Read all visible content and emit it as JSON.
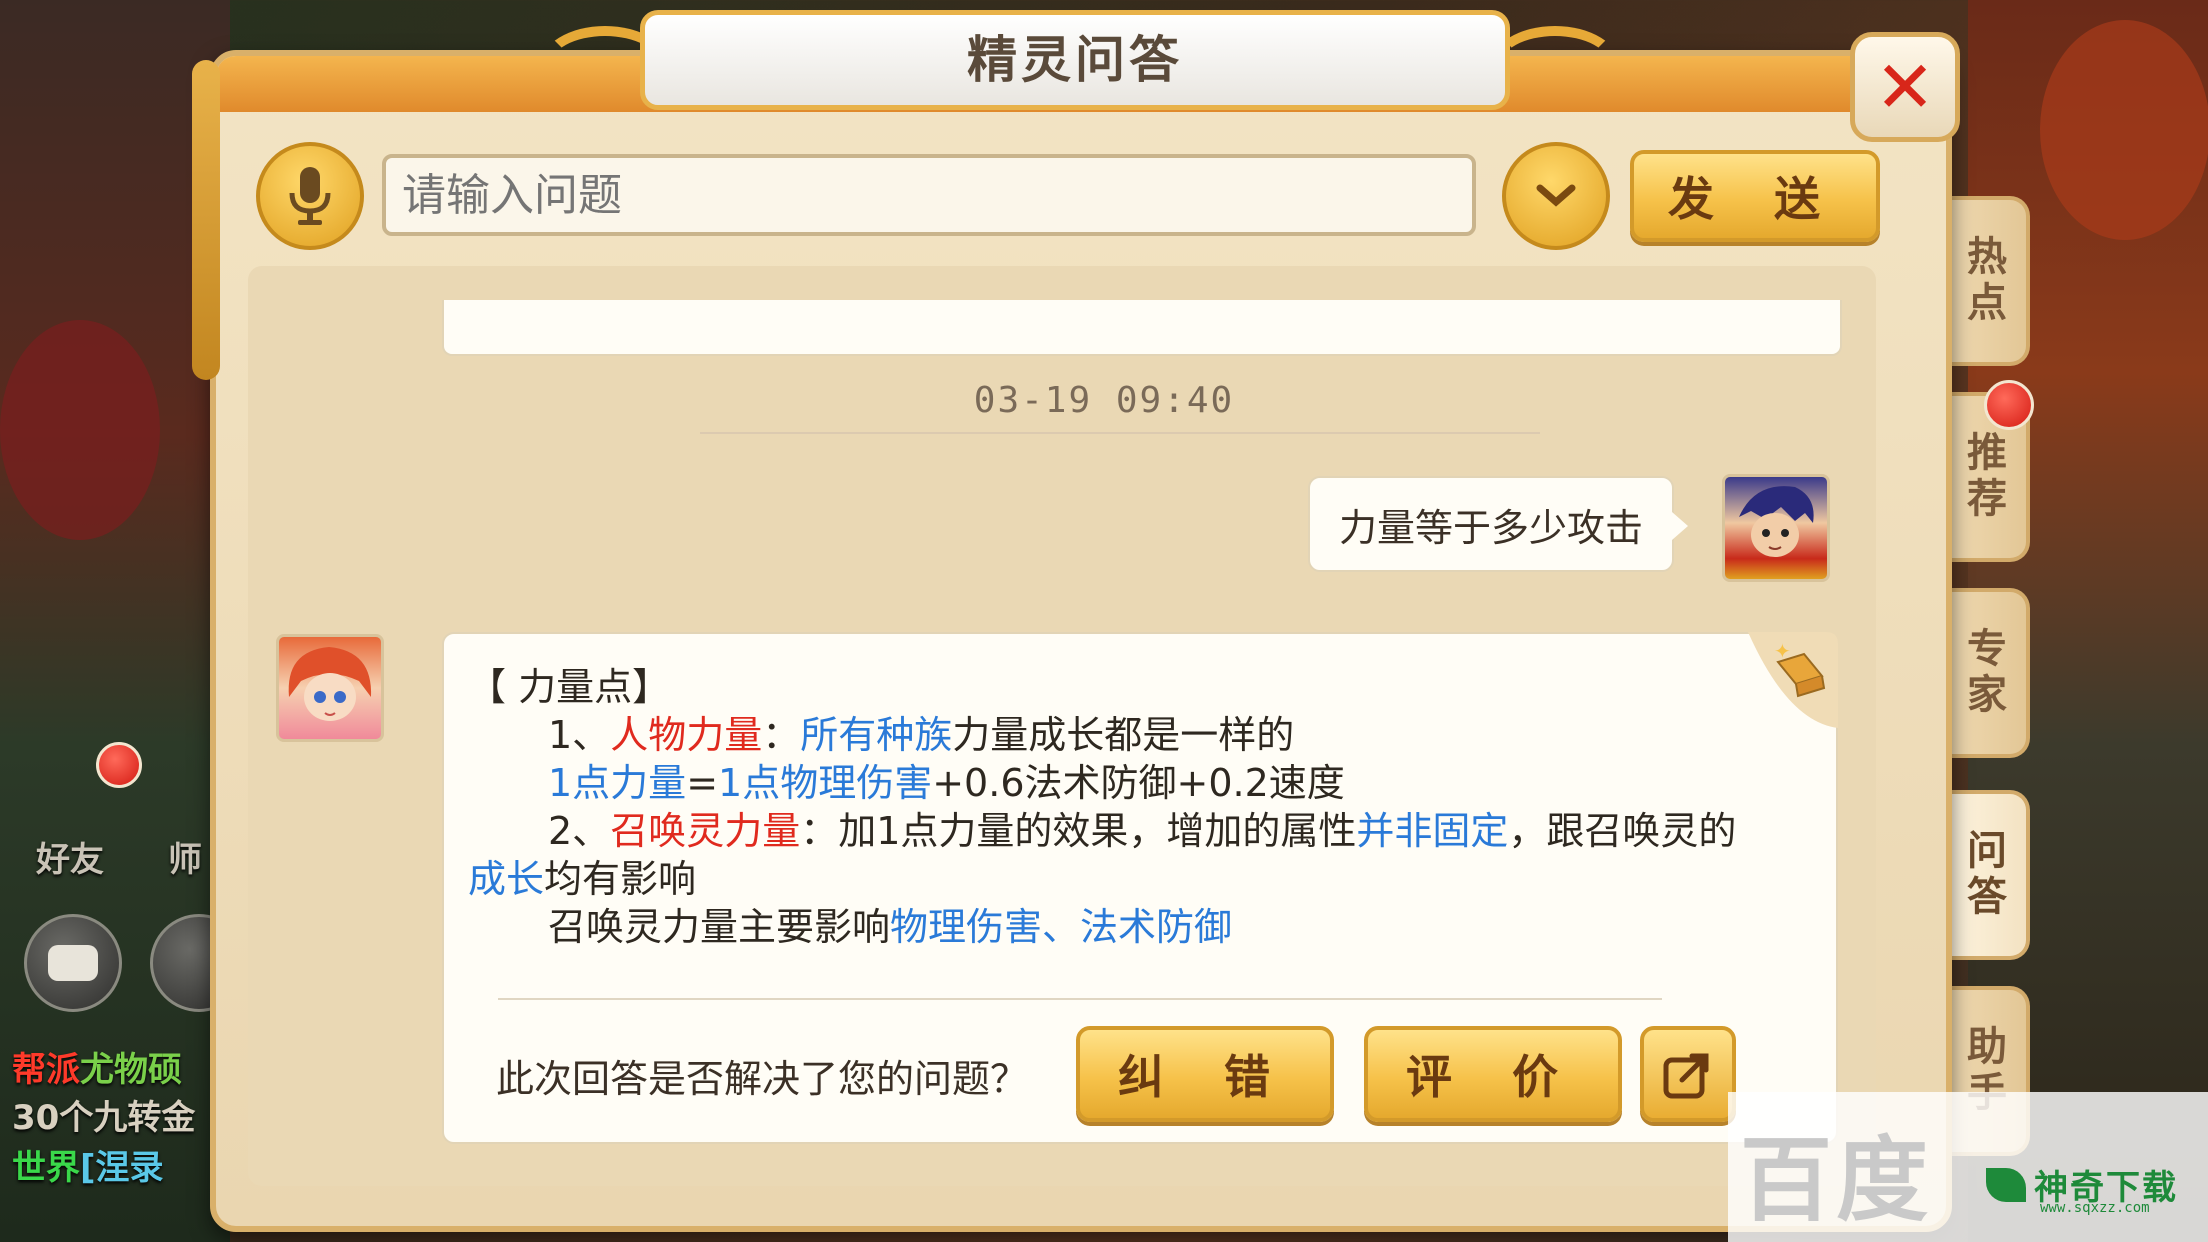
{
  "title": "精灵问答",
  "input": {
    "placeholder": "请输入问题",
    "value": ""
  },
  "send_label": "发 送",
  "timestamp": "03-19 09:40",
  "user_question": "力量等于多少攻击",
  "answer": {
    "heading": "【 力量点】",
    "l1_num": "1、",
    "l1_red": "人物力量",
    "l1_sep": "：",
    "l1_blue": "所有种族",
    "l1_rest": "力量成长都是一样的",
    "l2_blue": "1点力量",
    "l2_eq": "=",
    "l2_blue2": "1点物理伤害",
    "l2_rest": "+0.6法术防御+0.2速度",
    "l3_num": "2、",
    "l3_red": "召唤灵力量",
    "l3_mid": "：加1点力量的效果，增加的属性",
    "l3_blue": "并非固定",
    "l3_rest": "，跟召唤灵的",
    "l4_blue": "成长",
    "l4_rest": "均有影响",
    "l5_text": "召唤灵力量主要影响",
    "l5_blue": "物理伤害、法术防御"
  },
  "feedback": {
    "question": "此次回答是否解决了您的问题？",
    "correct_label": "纠 错",
    "rate_label": "评 价"
  },
  "side_tabs": [
    "热点",
    "推荐",
    "专家",
    "问答",
    "助手"
  ],
  "hud": {
    "friend_label": "好友",
    "master_label": "师",
    "chat_lines": [
      {
        "channel": "帮派",
        "text": "尤物硕"
      },
      {
        "channel": "",
        "text": "30个九转金"
      },
      {
        "channel": "世界",
        "text": "[涅录"
      }
    ]
  },
  "watermark": {
    "baidu": "百度",
    "brand": "神奇下载",
    "url": "www.sqxzz.com"
  },
  "colors": {
    "accent_gold": "#f6c24a",
    "red_text": "#e02a1e",
    "blue_text": "#2a7ad8",
    "close_red": "#d8261a"
  }
}
